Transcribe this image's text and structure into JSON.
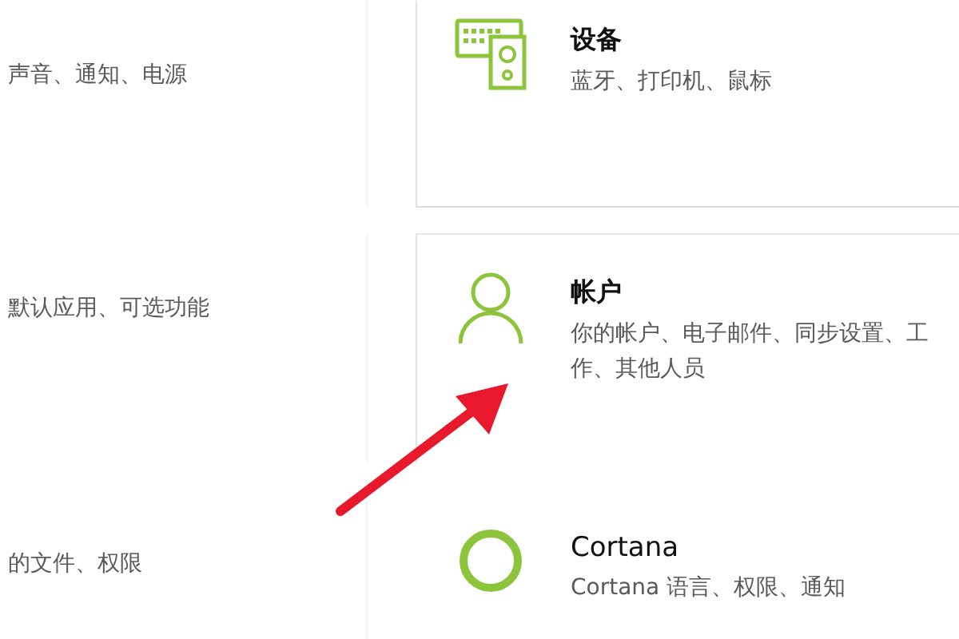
{
  "left_items": [
    {
      "description": "声音、通知、电源"
    },
    {
      "description": "默认应用、可选功能"
    },
    {
      "description": "的文件、权限"
    }
  ],
  "right_items": [
    {
      "kind": "devices",
      "title": "设备",
      "description": "蓝牙、打印机、鼠标"
    },
    {
      "kind": "accounts",
      "title": "帐户",
      "description": "你的帐户、电子邮件、同步设置、工作、其他人员"
    },
    {
      "kind": "cortana",
      "title": "Cortana",
      "description": "Cortana 语言、权限、通知"
    }
  ]
}
